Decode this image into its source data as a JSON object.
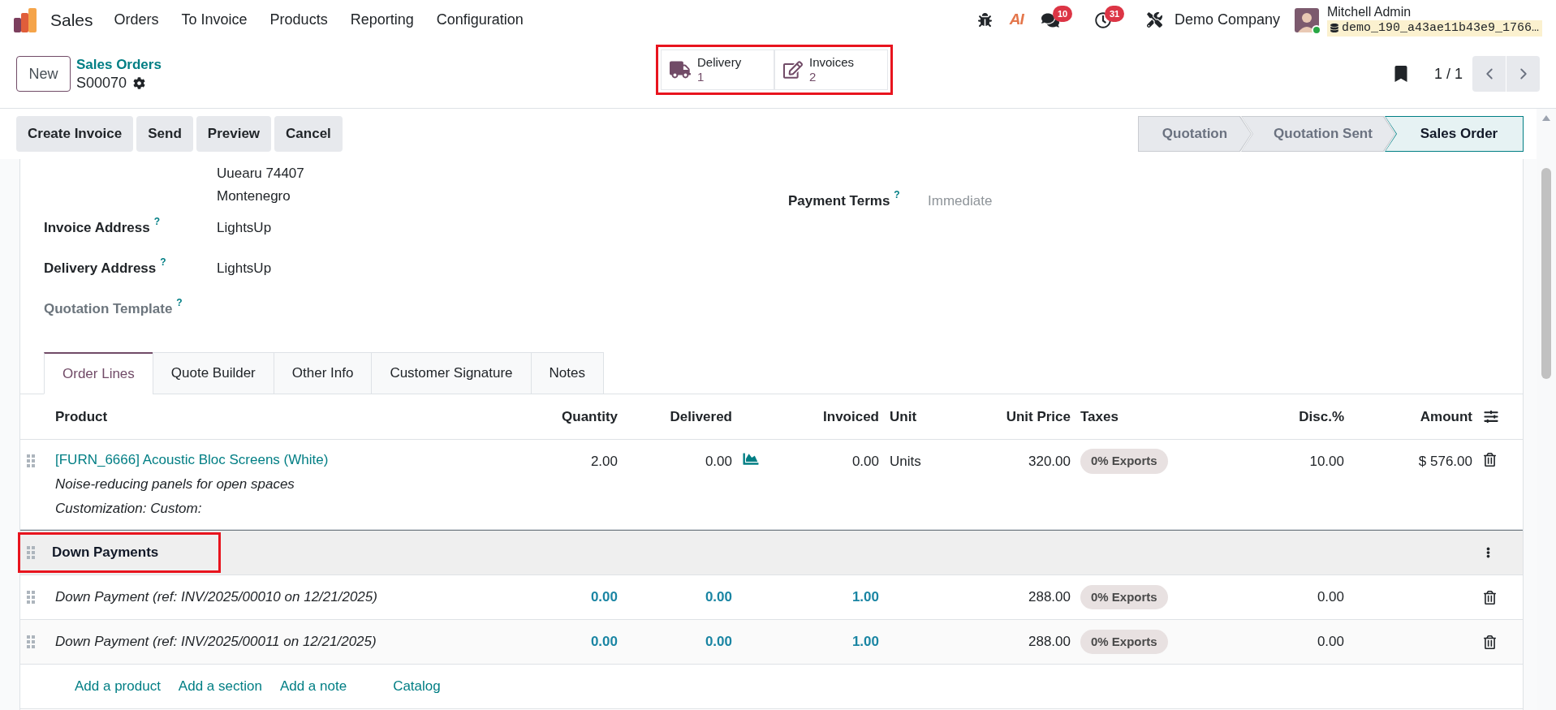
{
  "navbar": {
    "app_name": "Sales",
    "menu": [
      "Orders",
      "To Invoice",
      "Products",
      "Reporting",
      "Configuration"
    ],
    "ai_label": "AI",
    "messages_count": "10",
    "activities_count": "31",
    "company": "Demo Company",
    "user_name": "Mitchell Admin",
    "database": "demo_190_a43ae11b43e9_1766…",
    "online": true
  },
  "control_panel": {
    "new_button": "New",
    "breadcrumb": "Sales Orders",
    "record": "S00070",
    "smart_buttons_highlighted": true,
    "smart_buttons": [
      {
        "kind": "delivery",
        "label": "Delivery",
        "count": "1"
      },
      {
        "kind": "invoices",
        "label": "Invoices",
        "count": "2"
      }
    ],
    "pager": "1 / 1"
  },
  "actions": [
    "Create Invoice",
    "Send",
    "Preview",
    "Cancel"
  ],
  "statusbar": [
    {
      "label": "Quotation",
      "selected": false
    },
    {
      "label": "Quotation Sent",
      "selected": false
    },
    {
      "label": "Sales Order",
      "selected": true
    }
  ],
  "form": {
    "address_lines": [
      "Uuearu 74407",
      "Montenegro"
    ],
    "fields": [
      {
        "label": "Invoice Address",
        "help": "?",
        "value": "LightsUp",
        "muted": false
      },
      {
        "label": "Delivery Address",
        "help": "?",
        "value": "LightsUp",
        "muted": false
      },
      {
        "label": "Quotation Template",
        "help": "?",
        "muted": true
      }
    ],
    "right_fields": [
      {
        "label": "Payment Terms",
        "help": "?",
        "placeholder": "Immediate"
      }
    ]
  },
  "tabs": [
    {
      "label": "Order Lines",
      "selected": true
    },
    {
      "label": "Quote Builder",
      "selected": false
    },
    {
      "label": "Other Info",
      "selected": false
    },
    {
      "label": "Customer Signature",
      "selected": false
    },
    {
      "label": "Notes",
      "selected": false
    }
  ],
  "table": {
    "columns": [
      "Product",
      "Quantity",
      "Delivered",
      "Invoiced",
      "Unit",
      "Unit Price",
      "Taxes",
      "Disc.%",
      "Amount"
    ],
    "rows": [
      {
        "kind": "product",
        "product": "[FURN_6666] Acoustic Bloc Screens (White)",
        "description": [
          "Noise-reducing panels for open spaces",
          "Customization: Custom:"
        ],
        "quantity": "2.00",
        "delivered": "0.00",
        "invoiced": "0.00",
        "unit": "Units",
        "unit_price": "320.00",
        "taxes": [
          "0% Exports"
        ],
        "discount": "10.00",
        "amount": "$ 576.00"
      },
      {
        "kind": "section",
        "name": "Down Payments",
        "highlighted": true
      },
      {
        "kind": "down_payment",
        "description": "Down Payment (ref: INV/2025/00010 on 12/21/2025)",
        "quantity": "0.00",
        "delivered": "0.00",
        "invoiced": "1.00",
        "unit_price": "288.00",
        "taxes": [
          "0% Exports"
        ],
        "discount": "0.00"
      },
      {
        "kind": "down_payment",
        "description": "Down Payment (ref: INV/2025/00011 on 12/21/2025)",
        "quantity": "0.00",
        "delivered": "0.00",
        "invoiced": "1.00",
        "unit_price": "288.00",
        "taxes": [
          "0% Exports"
        ],
        "discount": "0.00"
      }
    ],
    "add_links": [
      "Add a product",
      "Add a section",
      "Add a note"
    ],
    "catalog": "Catalog"
  }
}
